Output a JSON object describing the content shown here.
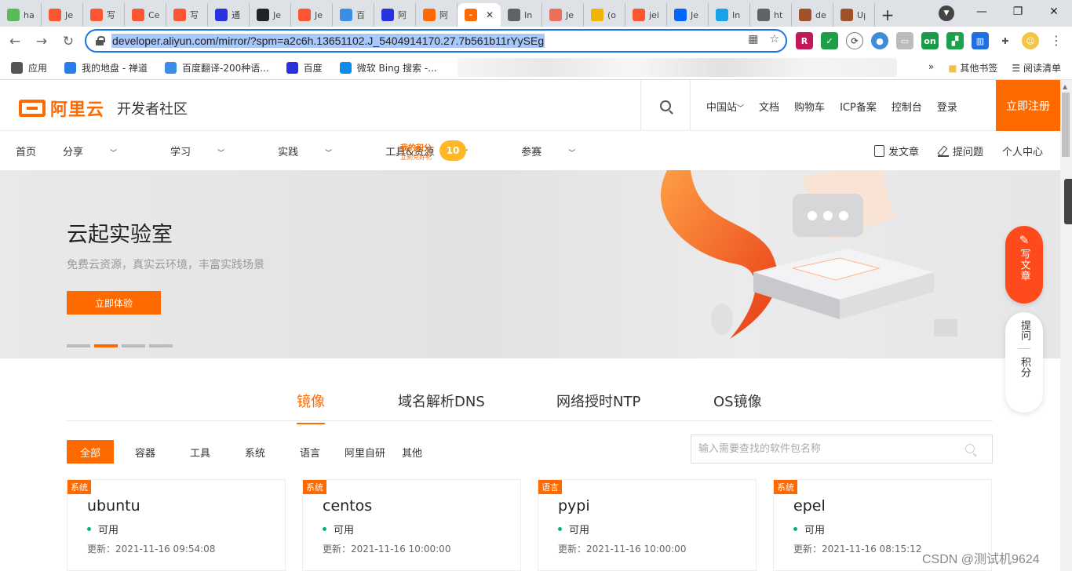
{
  "browser": {
    "tabs": [
      {
        "label": "ha",
        "icon": "hao123-icon",
        "color": "#5cb85c"
      },
      {
        "label": "Je",
        "icon": "csdn-icon",
        "color": "#fc5531"
      },
      {
        "label": "写",
        "icon": "csdn-icon",
        "color": "#fc5531"
      },
      {
        "label": "Ce",
        "icon": "csdn-icon",
        "color": "#fc5531"
      },
      {
        "label": "写",
        "icon": "csdn-icon",
        "color": "#fc5531"
      },
      {
        "label": "通",
        "icon": "baidu-paw-icon",
        "color": "#2932e1"
      },
      {
        "label": "Je",
        "icon": "fs-icon",
        "color": "#222222"
      },
      {
        "label": "Je",
        "icon": "csdn-icon",
        "color": "#fc5531"
      },
      {
        "label": "百",
        "icon": "translate-icon",
        "color": "#3a8ee6"
      },
      {
        "label": "阿",
        "icon": "baidu-paw-icon",
        "color": "#2932e1"
      },
      {
        "label": "阿",
        "icon": "aliyun-icon",
        "color": "#ff6a00"
      },
      {
        "label": "In",
        "icon": "globe-icon",
        "color": "#5f6368"
      },
      {
        "label": "Je",
        "icon": "jianshu-icon",
        "color": "#ea6f5a"
      },
      {
        "label": "(o",
        "icon": "fruit-icon",
        "color": "#f0b400"
      },
      {
        "label": "jei",
        "icon": "csdn-icon",
        "color": "#fc5531"
      },
      {
        "label": "Je",
        "icon": "zhihu-icon",
        "color": "#0066ff"
      },
      {
        "label": "In",
        "icon": "bird-icon",
        "color": "#1aa3e8"
      },
      {
        "label": "ht",
        "icon": "globe-icon",
        "color": "#5f6368"
      },
      {
        "label": "de",
        "icon": "avatar-icon",
        "color": "#a0522d"
      },
      {
        "label": "Uן",
        "icon": "avatar-icon",
        "color": "#a0522d"
      }
    ],
    "active_tab_icon": "aliyun-icon",
    "active_tab_close": "✕",
    "new_tab": "+",
    "url": "developer.aliyun.com/mirror/?spm=a2c6h.13651102.J_5404914170.27.7b561b11rYySEg"
  },
  "bookmarks": {
    "items": [
      {
        "label": "应用",
        "color": "#555555"
      },
      {
        "label": "我的地盘 - 禅道",
        "color": "#2b7de9"
      },
      {
        "label": "百度翻译-200种语...",
        "color": "#3a8ee6"
      },
      {
        "label": "百度",
        "color": "#2932e1"
      },
      {
        "label": "微软 Bing 搜索 -...",
        "color": "#0c8ce9"
      }
    ],
    "more": "»",
    "other": "其他书签",
    "reading_list": "阅读清单"
  },
  "site": {
    "brand": "阿里云",
    "subtitle": "开发者社区",
    "header_links": [
      "中国站",
      "文档",
      "购物车",
      "ICP备案",
      "控制台",
      "登录"
    ],
    "register": "立即注册",
    "subnav": [
      "首页",
      "分享",
      "学习",
      "实践",
      "工具&资源",
      "参赛"
    ],
    "points_title": "我的积分",
    "points_sub": "立刻兑好礼",
    "points_value": "10",
    "subnav_right": [
      "发文章",
      "提问题",
      "个人中心"
    ]
  },
  "banner": {
    "title": "云起实验室",
    "subtitle": "免费云资源，真实云环境，丰富实践场景",
    "button": "立即体验"
  },
  "fab": {
    "write": "写文章",
    "ask": "提问",
    "points": "积分"
  },
  "mirror": {
    "tabs": [
      "镜像",
      "域名解析DNS",
      "网络授时NTP",
      "OS镜像"
    ],
    "filters": [
      "全部",
      "容器",
      "工具",
      "系统",
      "语言",
      "阿里自研",
      "其他"
    ],
    "search_placeholder": "输入需要查找的软件包名称",
    "cards": [
      {
        "tag": "系统",
        "name": "ubuntu",
        "status": "可用",
        "updated": "更新：2021-11-16 09:54:08"
      },
      {
        "tag": "系统",
        "name": "centos",
        "status": "可用",
        "updated": "更新：2021-11-16 10:00:00"
      },
      {
        "tag": "语言",
        "name": "pypi",
        "status": "可用",
        "updated": "更新：2021-11-16 10:00:00"
      },
      {
        "tag": "系统",
        "name": "epel",
        "status": "可用",
        "updated": "更新：2021-11-16 08:15:12"
      }
    ]
  },
  "watermark": "CSDN @测试机9624",
  "colors": {
    "accent": "#ff6a00",
    "status_ok": "#00b578",
    "url_highlight": "#a8c7fa"
  }
}
